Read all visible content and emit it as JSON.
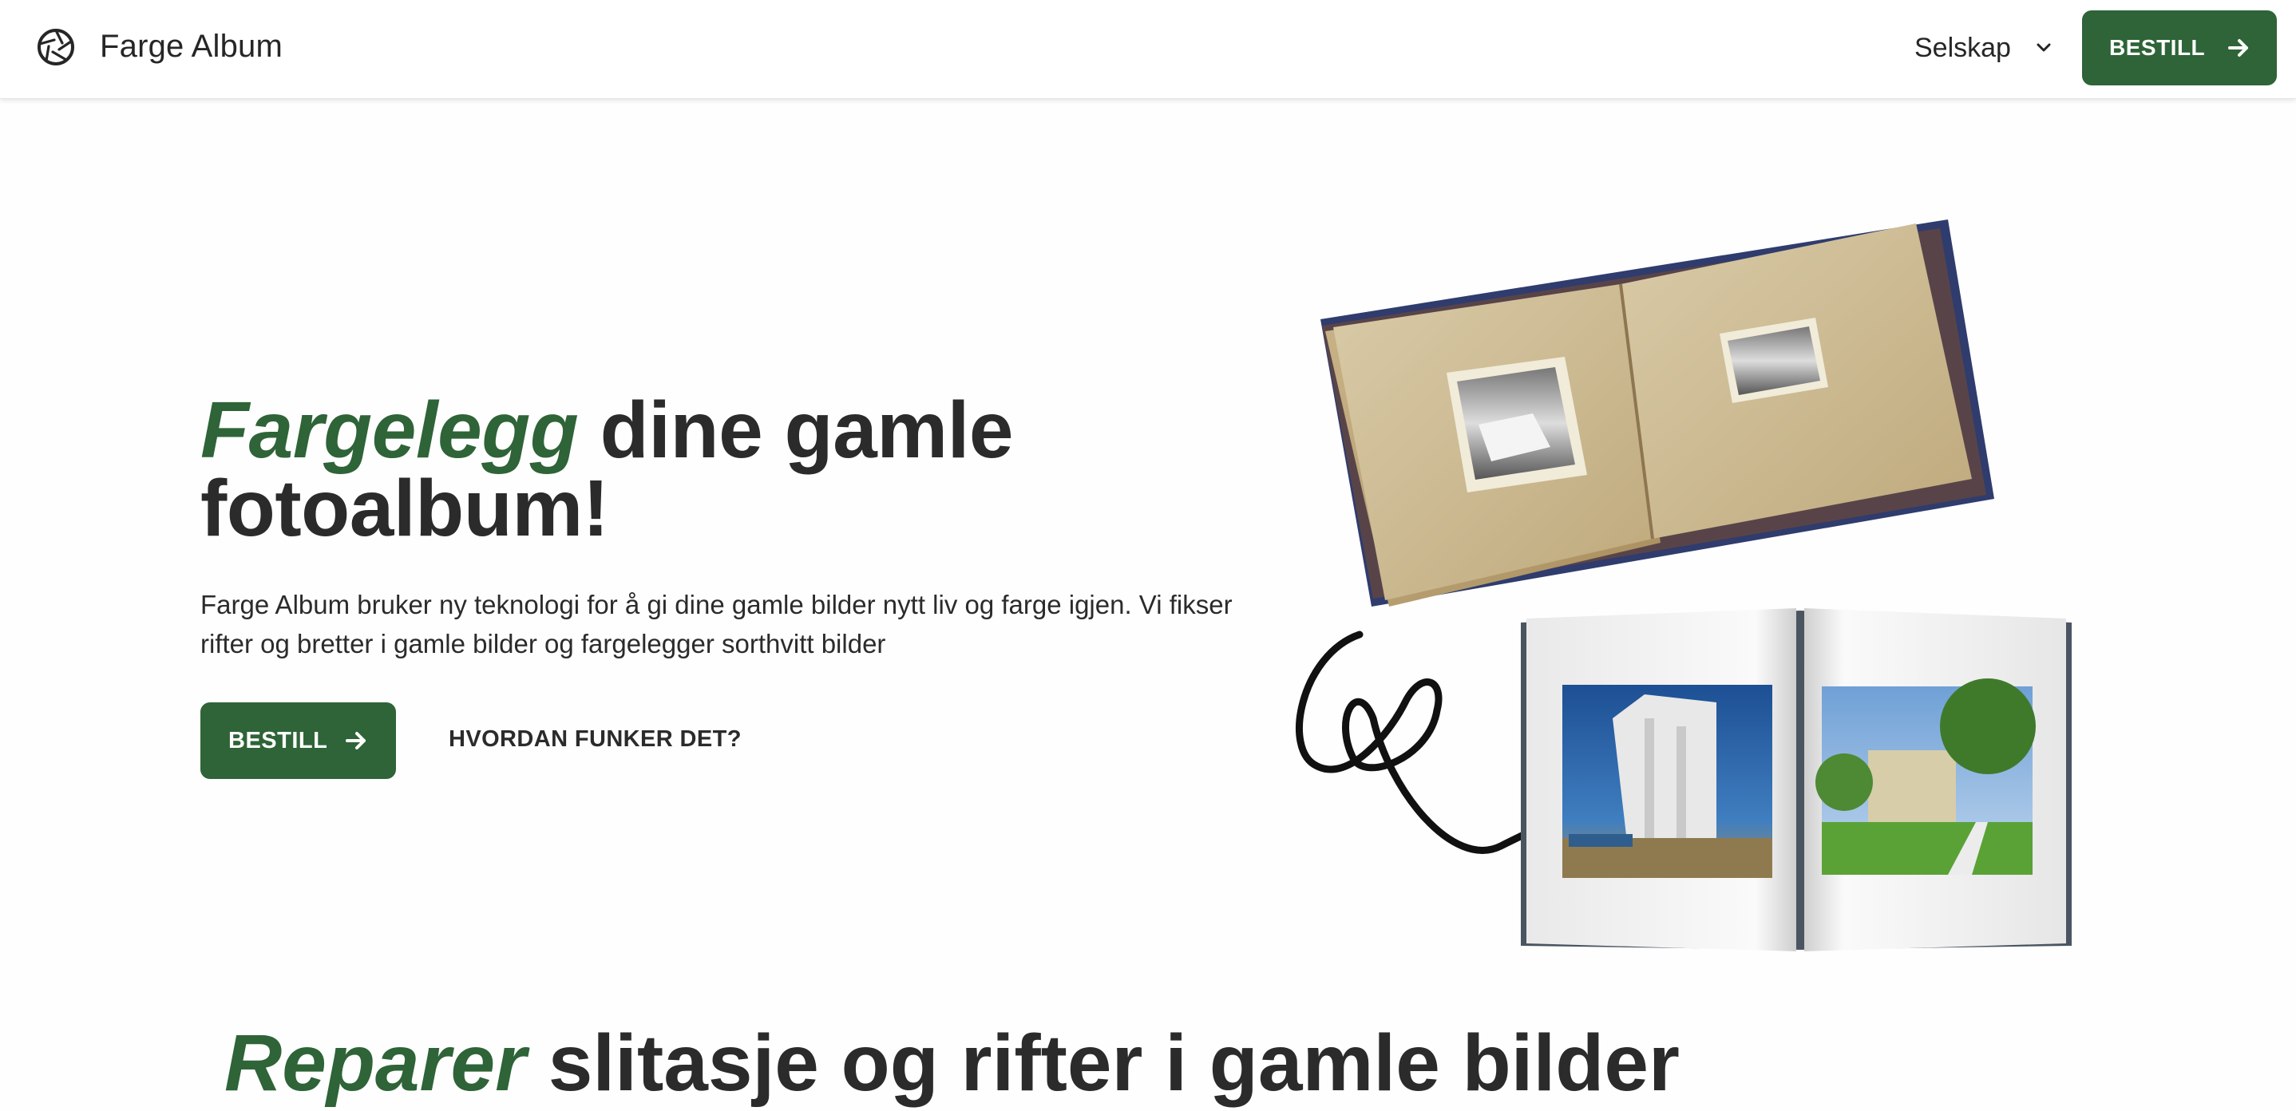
{
  "header": {
    "brand": "Farge Album",
    "logo_icon": "aperture-icon",
    "nav_company_label": "Selskap",
    "nav_company_icon": "chevron-down-icon",
    "order_button_label": "BESTILL",
    "order_button_icon": "arrow-right-icon"
  },
  "hero": {
    "title_accent": "Fargelegg",
    "title_rest": " dine gamle fotoalbum!",
    "description": "Farge Album bruker ny teknologi for å gi dine gamle bilder nytt liv og farge igjen. Vi fikser rifter og bretter i gamle bilder og fargelegger sorthvitt bilder",
    "order_button_label": "BESTILL",
    "order_button_icon": "arrow-right-icon",
    "how_link_label": "HVORDAN FUNKER DET?"
  },
  "illustration": {
    "old_album": "old-photo-album-image",
    "curly_arrow": "curly-arrow-icon",
    "new_album": "color-photo-book-image"
  },
  "section2": {
    "title_accent": "Reparer",
    "title_rest": " slitasje og rifter i gamle bilder"
  },
  "colors": {
    "accent": "#2e6437",
    "text": "#2b2b2b",
    "background": "#fefefe"
  }
}
